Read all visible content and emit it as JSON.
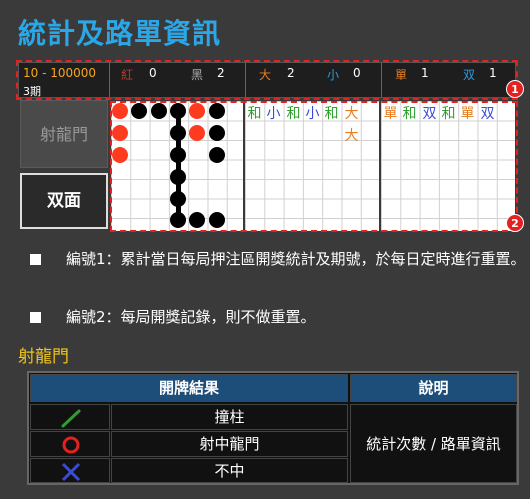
{
  "title": "統計及路單資訊",
  "stats": {
    "range": "10 - 100000",
    "period": "3期",
    "red_label": "紅",
    "red_value": "0",
    "black_label": "黑",
    "black_value": "2",
    "big_label": "大",
    "big_value": "2",
    "small_label": "小",
    "small_value": "0",
    "odd_label": "單",
    "odd_value": "1",
    "even_label": "双",
    "even_value": "1"
  },
  "badges": {
    "one": "1",
    "two": "2"
  },
  "tabs": {
    "dragon_gate": "射龍門",
    "double": "双面"
  },
  "road_bigsmall": [
    "和",
    "小",
    "和",
    "小",
    "和",
    "大"
  ],
  "road_bigsmall_row2": "大",
  "road_oddeven": [
    "單",
    "和",
    "双",
    "和",
    "單",
    "双"
  ],
  "notes": {
    "n1": "編號1：累計當日每局押注區開獎統計及期號，於每日定時進行重置。",
    "n2": "編號2：每局開獎記錄，則不做重置。"
  },
  "section_title": "射龍門",
  "legend": {
    "col1_header": "開牌結果",
    "col2_header": "說明",
    "rows": [
      "撞柱",
      "射中龍門",
      "不中"
    ],
    "description": "統計次數 / 路單資訊"
  },
  "colors": {
    "title": "#2aa7e8",
    "accent": "#e32121",
    "green_icon": "#2e9e2e",
    "red_icon": "#e32121",
    "blue_icon": "#3b4bd6"
  }
}
